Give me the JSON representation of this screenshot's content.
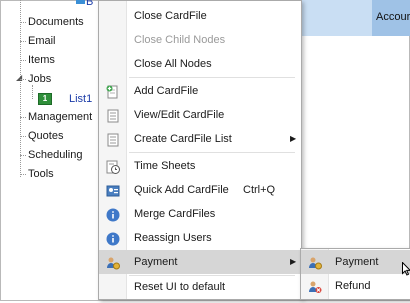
{
  "tree": {
    "items": [
      "Documents",
      "Email",
      "Items",
      "Jobs",
      "Management",
      "Quotes",
      "Scheduling",
      "Tools"
    ],
    "jobs_child": "List1",
    "top_partial": "B"
  },
  "grid_header": {
    "column": "Accour"
  },
  "context_menu": {
    "items": {
      "close_cardfile": "Close CardFile",
      "close_child_nodes": "Close Child Nodes",
      "close_all_nodes": "Close All Nodes",
      "add_cardfile": "Add CardFile",
      "view_edit_cardfile": "View/Edit CardFile",
      "create_cardfile_list": "Create CardFile List",
      "time_sheets": "Time Sheets",
      "quick_add_cardfile": "Quick Add CardFile",
      "quick_add_shortcut": "Ctrl+Q",
      "merge_cardfiles": "Merge CardFiles",
      "reassign_users": "Reassign Users",
      "payment": "Payment",
      "reset_ui": "Reset UI to default"
    }
  },
  "submenu": {
    "payment": "Payment",
    "refund": "Refund"
  }
}
